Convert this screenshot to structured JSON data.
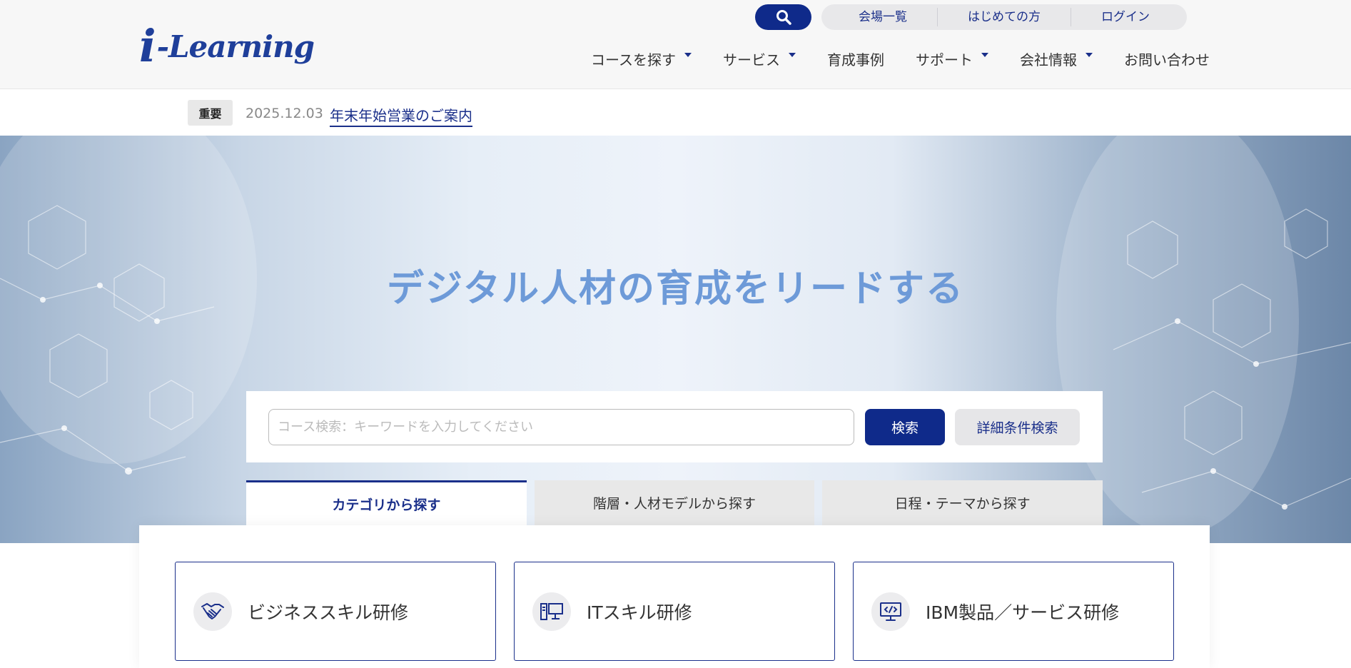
{
  "header": {
    "logo_text": "-Learning",
    "logo_mark": "i",
    "util_links": [
      "会場一覧",
      "はじめての方",
      "ログイン"
    ],
    "nav": [
      {
        "label": "コースを探す",
        "dropdown": true
      },
      {
        "label": "サービス",
        "dropdown": true
      },
      {
        "label": "育成事例",
        "dropdown": false
      },
      {
        "label": "サポート",
        "dropdown": true
      },
      {
        "label": "会社情報",
        "dropdown": true
      },
      {
        "label": "お問い合わせ",
        "dropdown": false
      }
    ]
  },
  "notice": {
    "badge": "重要",
    "date": "2025.12.03",
    "link": "年末年始営業のご案内"
  },
  "hero": {
    "title": "デジタル人材の育成をリードする"
  },
  "search": {
    "placeholder": "コース検索：キーワードを入力してください",
    "submit_label": "検索",
    "detail_label": "詳細条件検索"
  },
  "tabs": [
    {
      "label": "カテゴリから探す",
      "active": true
    },
    {
      "label": "階層・人材モデルから探す",
      "active": false
    },
    {
      "label": "日程・テーマから探す",
      "active": false
    }
  ],
  "categories": [
    {
      "label": "ビジネススキル研修",
      "icon": "handshake-icon"
    },
    {
      "label": "ITスキル研修",
      "icon": "computer-icon"
    },
    {
      "label": "IBM製品／サービス研修",
      "icon": "monitor-code-icon"
    }
  ],
  "colors": {
    "brand": "#0f2a8a",
    "hero_title": "#6d9ad8"
  }
}
